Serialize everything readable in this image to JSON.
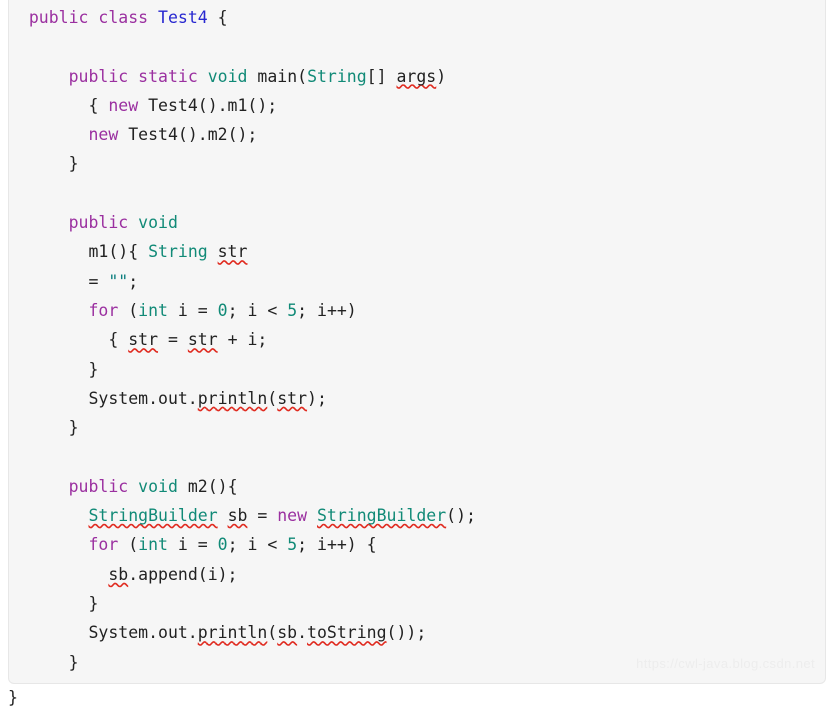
{
  "document": {
    "kind": "java-source-code-snippet",
    "language": "Java",
    "class_name": "Test4",
    "background_color": "#f6f6f6",
    "border_color": "#e7e7e7",
    "colors": {
      "keyword": "#9b30a0",
      "type": "#118a77",
      "class_name": "#2727d0",
      "number": "#118a77",
      "string": "#0c7f7f",
      "plain_text": "#222222",
      "spellcheck_underline": "#e02b20",
      "watermark": "#ededed"
    }
  },
  "code": {
    "lines": [
      {
        "id": "line-1",
        "text": "public class Test4 {"
      },
      {
        "id": "line-2",
        "text": ""
      },
      {
        "id": "line-3",
        "text": "    public static void main(String[] args)"
      },
      {
        "id": "line-4",
        "text": "        { new Test4().m1();"
      },
      {
        "id": "line-5",
        "text": "        new Test4().m2();"
      },
      {
        "id": "line-6",
        "text": "    }"
      },
      {
        "id": "line-7",
        "text": ""
      },
      {
        "id": "line-8",
        "text": "    public void"
      },
      {
        "id": "line-9",
        "text": "        m1(){ String str"
      },
      {
        "id": "line-10",
        "text": "        = \"\";"
      },
      {
        "id": "line-11",
        "text": "        for (int i = 0; i < 5; i++)"
      },
      {
        "id": "line-12",
        "text": "            { str = str + i;"
      },
      {
        "id": "line-13",
        "text": "        }"
      },
      {
        "id": "line-14",
        "text": "        System.out.println(str);"
      },
      {
        "id": "line-15",
        "text": "    }"
      },
      {
        "id": "line-16",
        "text": ""
      },
      {
        "id": "line-17",
        "text": "    public void m2(){"
      },
      {
        "id": "line-18",
        "text": "        StringBuilder sb = new StringBuilder();"
      },
      {
        "id": "line-19",
        "text": "        for (int i = 0; i < 5; i++) {"
      },
      {
        "id": "line-20",
        "text": "            sb.append(i);"
      },
      {
        "id": "line-21",
        "text": "        }"
      },
      {
        "id": "line-22",
        "text": "        System.out.println(sb.toString());"
      },
      {
        "id": "line-23",
        "text": "    }"
      }
    ],
    "trailing_brace": "}",
    "spellchecked_identifiers": [
      "args",
      "str",
      "println",
      "StringBuilder",
      "sb",
      "toString"
    ]
  },
  "watermark": {
    "text": "https://cwl-java.blog.csdn.net"
  }
}
